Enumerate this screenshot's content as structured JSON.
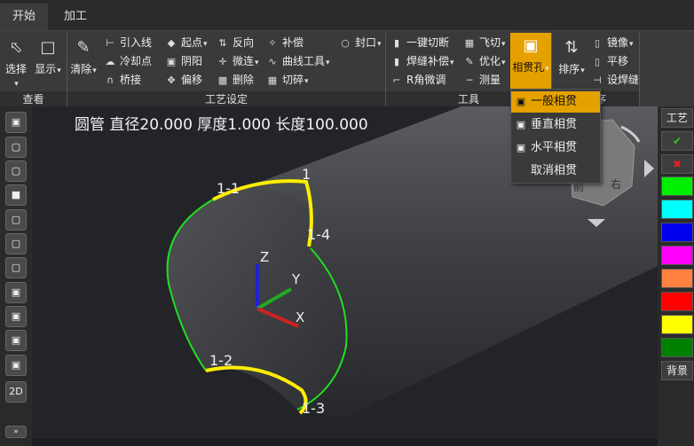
{
  "tabs": [
    {
      "label": "开始"
    },
    {
      "label": "加工"
    }
  ],
  "groups": {
    "view": "查看",
    "process": "工艺设定",
    "tools": "工具",
    "sort": "排序"
  },
  "view_buttons": {
    "select": "选择",
    "display": "显示"
  },
  "process_buttons": {
    "clear": "清除",
    "lead_line": "引入线",
    "start_point": "起点",
    "reverse": "反向",
    "compensate": "补偿",
    "seal": "封口",
    "cool_point": "冷却点",
    "yin_yang": "阴阳",
    "micro_joint": "微连",
    "curve_tool": "曲线工具",
    "bridge": "桥接",
    "offset": "偏移",
    "delete": "删除",
    "cut_tool": "切碎"
  },
  "tools_buttons": {
    "one_key_cut": "一键切断",
    "fly_cut": "飞切",
    "weld_comp": "焊缝补偿",
    "optimize": "优化",
    "r_corner": "R角微调",
    "measure": "测量",
    "intersect_hole": "相贯孔"
  },
  "sort_buttons": {
    "sort": "排序",
    "mirror": "镜像",
    "translate": "平移",
    "weld_setting": "设焊缝"
  },
  "dropdown": {
    "items": [
      {
        "label": "一般相贯"
      },
      {
        "label": "垂直相贯"
      },
      {
        "label": "水平相贯"
      },
      {
        "label": "取消相贯"
      }
    ]
  },
  "viewport": {
    "info": "圆管 直径20.000 厚度1.000 长度100.000",
    "labels": {
      "l1": "1",
      "l11": "1-1",
      "l14": "1-4",
      "l12": "1-2",
      "l13": "1-3",
      "ax_z": "Z",
      "ax_y": "Y",
      "ax_x": "X",
      "cube_front": "前",
      "cube_right": "右"
    }
  },
  "left_tools": {
    "two_d": "2D"
  },
  "right_tools": {
    "craft": "工艺",
    "background": "背景",
    "colors": [
      "#00ee00",
      "#00ffff",
      "#0000ee",
      "#ff00ff",
      "#ff8040",
      "#ff0000",
      "#ffff00",
      "#008000"
    ]
  },
  "colors": {
    "accent": "#e5a100",
    "path_green": "#22dd22",
    "path_yellow": "#ffee00"
  }
}
